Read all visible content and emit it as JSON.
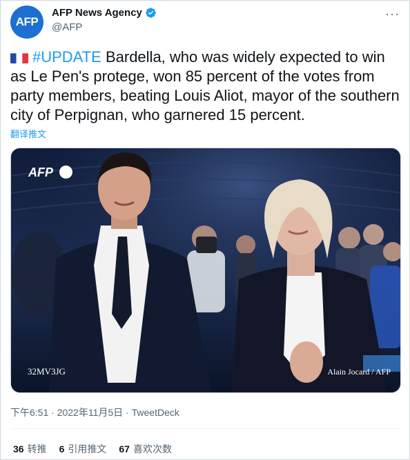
{
  "account": {
    "avatar_text": "AFP",
    "display_name": "AFP News Agency",
    "handle": "@AFP",
    "verified_icon": "verified-badge-icon",
    "more_icon": "more-options-icon",
    "brand_color": "#1d6fd1"
  },
  "tweet": {
    "flag_icon": "france-flag-icon",
    "hashtag": "#UPDATE",
    "body": " Bardella, who was widely expected to win as Le Pen's protege, won 85 percent of the votes from party members, beating Louis Aliot, mayor of the southern city of Perpignan, who garnered 15 percent.",
    "translate_label": "翻译推文"
  },
  "media": {
    "watermark": "AFP",
    "code": "32MV3JG",
    "credit": "Alain Jocard / AFP"
  },
  "meta": {
    "time": "下午6:51",
    "separator1": " · ",
    "date": "2022年11月5日",
    "separator2": " · ",
    "source": "TweetDeck"
  },
  "stats": [
    {
      "count": "36",
      "label": "转推"
    },
    {
      "count": "6",
      "label": "引用推文"
    },
    {
      "count": "67",
      "label": "喜欢次数"
    }
  ],
  "colors": {
    "link": "#1d9bf0",
    "secondary_text": "#536471",
    "border": "#cfd9de"
  }
}
